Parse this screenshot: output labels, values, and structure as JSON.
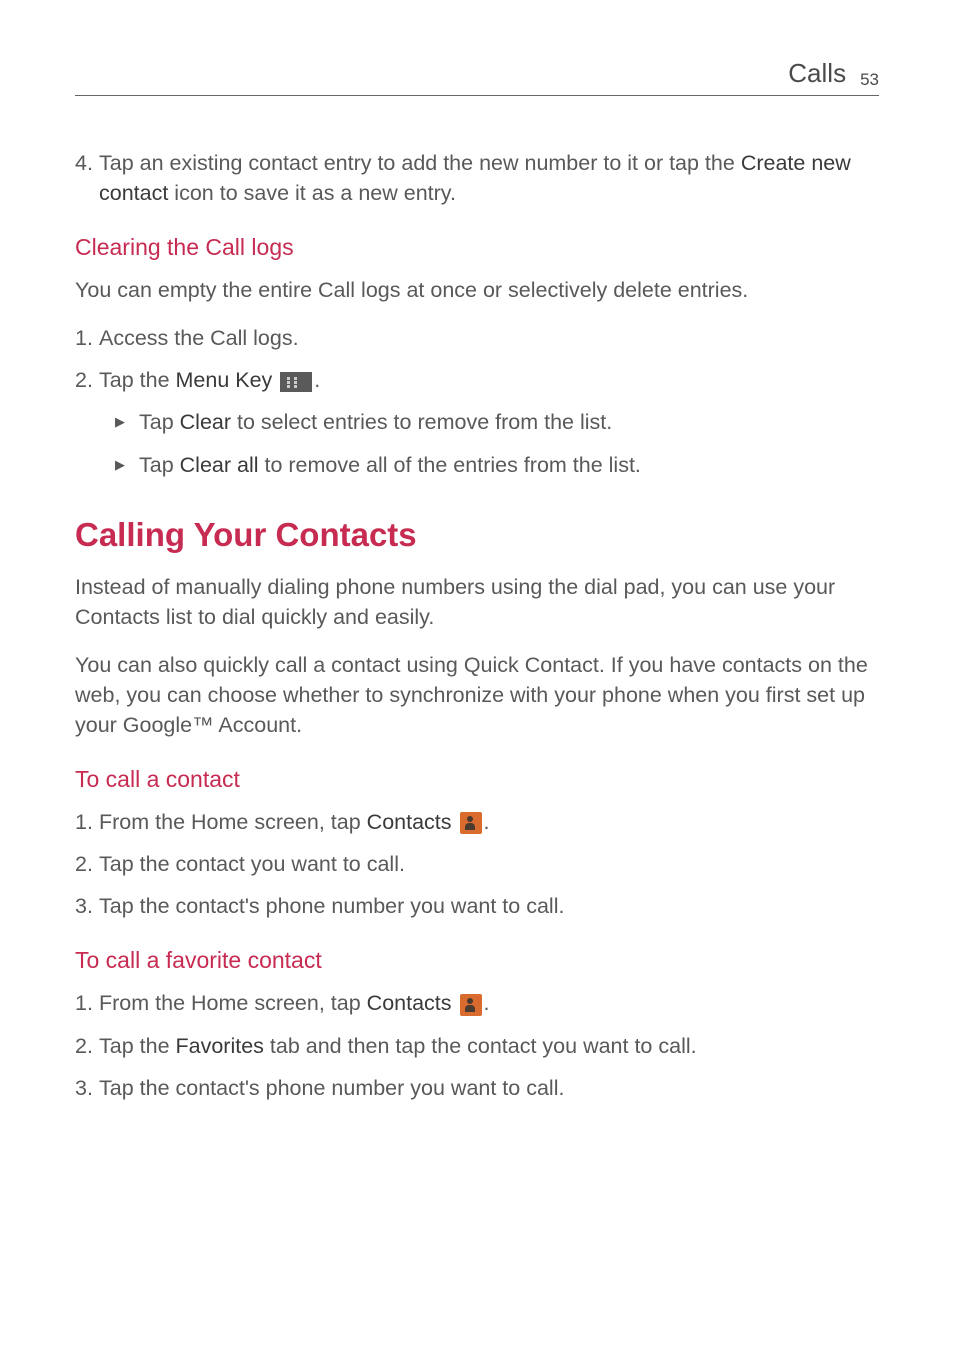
{
  "header": {
    "title": "Calls",
    "pageNumber": "53"
  },
  "intro": {
    "item4_num": "4.",
    "item4_before": "Tap an existing contact entry to add the new number to it or tap the ",
    "item4_bold": "Create new contact",
    "item4_after": " icon to save it as a new entry."
  },
  "clearing": {
    "heading": "Clearing the Call logs",
    "intro": "You can empty the entire Call logs at once or selectively delete entries.",
    "item1_num": "1.",
    "item1_text": "Access the Call logs.",
    "item2_num": "2.",
    "item2_before": "Tap the ",
    "item2_bold": "Menu Key",
    "item2_after": ".",
    "bullet1_before": "Tap ",
    "bullet1_bold": "Clear",
    "bullet1_after": " to select entries to remove from the list.",
    "bullet2_before": "Tap ",
    "bullet2_bold": "Clear all",
    "bullet2_after": " to remove all of the entries from the list."
  },
  "calling": {
    "heading": "Calling Your Contacts",
    "para1": "Instead of manually dialing phone numbers using the dial pad, you can use your Contacts list to dial quickly and easily.",
    "para2": "You can also quickly call a contact using Quick Contact. If you have contacts on the web, you can choose whether to synchronize with your phone when you first set up your Google™ Account."
  },
  "callContact": {
    "heading": "To call a contact",
    "item1_num": "1.",
    "item1_before": "From the Home screen, tap ",
    "item1_bold": "Contacts",
    "item1_after": ".",
    "item2_num": "2.",
    "item2_text": "Tap the contact you want to call.",
    "item3_num": "3.",
    "item3_text": "Tap the contact's phone number you want to call."
  },
  "callFavorite": {
    "heading": "To call a favorite contact",
    "item1_num": "1.",
    "item1_before": "From the Home screen, tap ",
    "item1_bold": "Contacts",
    "item1_after": ".",
    "item2_num": "2.",
    "item2_before": "Tap the ",
    "item2_bold": "Favorites",
    "item2_after": " tab and then tap the contact you want to call.",
    "item3_num": "3.",
    "item3_text": "Tap the contact's phone number you want to call."
  }
}
